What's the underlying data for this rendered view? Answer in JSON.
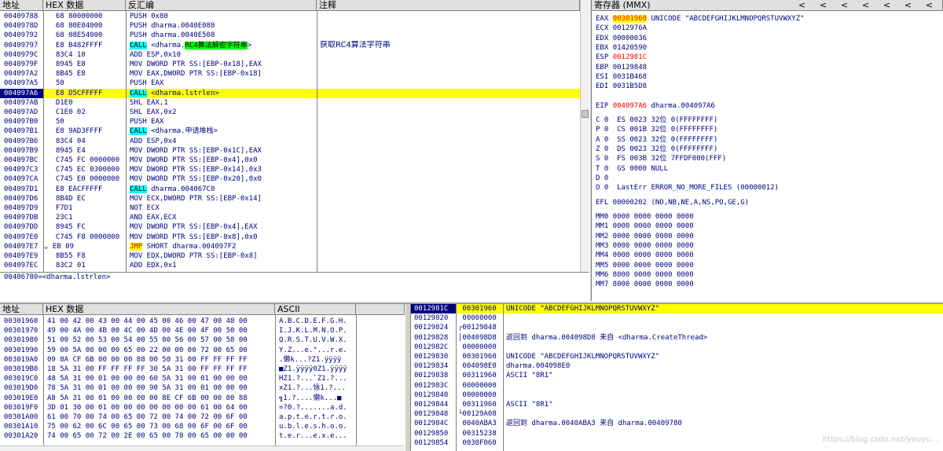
{
  "disasm": {
    "headers": {
      "addr": "地址",
      "hex": "HEX 数据",
      "asm": "反汇编",
      "comment": "注释"
    },
    "rows": [
      {
        "addr": "00409788",
        "hex": "68 80000000",
        "asm": "PUSH 0x80",
        "comment": ""
      },
      {
        "addr": "0040978D",
        "hex": "68 80E04000",
        "asm": "PUSH dharma.0040E080",
        "comment": ""
      },
      {
        "addr": "00409792",
        "hex": "68 08E54000",
        "asm": "PUSH dharma.0040E508",
        "comment": ""
      },
      {
        "addr": "00409797",
        "hex": "E8 B482FFFF",
        "asm_call": "CALL",
        "asm_pre": " <dharma.",
        "asm_green": "RC4算法解密字符串",
        "asm_post": ">",
        "comment": "获取RC4算法字符串"
      },
      {
        "addr": "0040979C",
        "hex": "83C4 10",
        "asm": "ADD ESP,0x10",
        "comment": ""
      },
      {
        "addr": "0040979F",
        "hex": "8945 E8",
        "asm": "MOV DWORD PTR SS:[EBP-0x18],EAX",
        "comment": ""
      },
      {
        "addr": "004097A2",
        "hex": "8B45 E8",
        "asm": "MOV EAX,DWORD PTR SS:[EBP-0x18]",
        "comment": ""
      },
      {
        "addr": "004097A5",
        "hex": "50",
        "asm": "PUSH EAX",
        "comment": ""
      },
      {
        "addr": "004097A6",
        "hex": "E8 D5CFFFFF",
        "asm_call": "CALL",
        "asm_pre": " <dharma.lstrlen>",
        "comment": "",
        "selected": true
      },
      {
        "addr": "004097AB",
        "hex": "D1E0",
        "asm": "SHL EAX,1",
        "comment": ""
      },
      {
        "addr": "004097AD",
        "hex": "C1E0 02",
        "asm": "SHL EAX,0x2",
        "comment": ""
      },
      {
        "addr": "004097B0",
        "hex": "50",
        "asm": "PUSH EAX",
        "comment": ""
      },
      {
        "addr": "004097B1",
        "hex": "E8 9AD3FFFF",
        "asm_call": "CALL",
        "asm_pre": " <dharma.申请堆栈>",
        "comment": ""
      },
      {
        "addr": "004097B6",
        "hex": "83C4 04",
        "asm": "ADD ESP,0x4",
        "comment": ""
      },
      {
        "addr": "004097B9",
        "hex": "8945 E4",
        "asm": "MOV DWORD PTR SS:[EBP-0x1C],EAX",
        "comment": ""
      },
      {
        "addr": "004097BC",
        "hex": "C745 FC 0000000",
        "asm": "MOV DWORD PTR SS:[EBP-0x4],0x0",
        "comment": ""
      },
      {
        "addr": "004097C3",
        "hex": "C745 EC 0300000",
        "asm": "MOV DWORD PTR SS:[EBP-0x14],0x3",
        "comment": ""
      },
      {
        "addr": "004097CA",
        "hex": "C745 E0 0000000",
        "asm": "MOV DWORD PTR SS:[EBP-0x20],0x0",
        "comment": ""
      },
      {
        "addr": "004097D1",
        "hex": "E8 EACFFFFF",
        "asm_call": "CALL",
        "asm_pre": " dharma.004067C0",
        "comment": ""
      },
      {
        "addr": "004097D6",
        "hex": "8B4D EC",
        "asm": "MOV ECX,DWORD PTR SS:[EBP-0x14]",
        "comment": ""
      },
      {
        "addr": "004097D9",
        "hex": "F7D1",
        "asm": "NOT ECX",
        "comment": ""
      },
      {
        "addr": "004097DB",
        "hex": "23C1",
        "asm": "AND EAX,ECX",
        "comment": ""
      },
      {
        "addr": "004097DD",
        "hex": "8945 FC",
        "asm": "MOV DWORD PTR SS:[EBP-0x4],EAX",
        "comment": ""
      },
      {
        "addr": "004097E0",
        "hex": "C745 F8 0000000",
        "asm": "MOV DWORD PTR SS:[EBP-0x8],0x0",
        "comment": ""
      },
      {
        "addr": "004097E7",
        "hex": "EB 09",
        "asm_jmp": "JMP",
        "asm_pre": " SHORT dharma.004097F2",
        "comment": "",
        "jmp_marker": "⌄"
      },
      {
        "addr": "004097E9",
        "hex": "8B55 F8",
        "asm": "MOV EDX,DWORD PTR SS:[EBP-0x8]",
        "comment": ""
      },
      {
        "addr": "004097EC",
        "hex": "83C2 01",
        "asm": "ADD EDX,0x1",
        "comment": ""
      }
    ],
    "info_line": "00406780=<dharma.lstrlen>"
  },
  "registers": {
    "title": "寄存器 (MMX)",
    "nav": [
      "<",
      "<",
      "<",
      "<",
      "<",
      "<",
      "<"
    ],
    "general": [
      {
        "name": "EAX",
        "value": "00301960",
        "extra": "UNICODE \"ABCDEFGHIJKLMNOPQRSTUVWXYZ\"",
        "highlight": true
      },
      {
        "name": "ECX",
        "value": "0012976A",
        "extra": ""
      },
      {
        "name": "EDX",
        "value": "00000036",
        "extra": ""
      },
      {
        "name": "EBX",
        "value": "01420590",
        "extra": ""
      },
      {
        "name": "ESP",
        "value": "0012981C",
        "extra": "",
        "red": true
      },
      {
        "name": "EBP",
        "value": "00129848",
        "extra": ""
      },
      {
        "name": "ESI",
        "value": "0031B468",
        "extra": ""
      },
      {
        "name": "EDI",
        "value": "0031B5D8",
        "extra": ""
      }
    ],
    "eip": {
      "name": "EIP",
      "value": "004097A6",
      "extra": "dharma.004097A6"
    },
    "flags": [
      "C 0  ES 0023 32位 0(FFFFFFFF)",
      "P 0  CS 001B 32位 0(FFFFFFFF)",
      "A 0  SS 0023 32位 0(FFFFFFFF)",
      "Z 0  DS 0023 32位 0(FFFFFFFF)",
      "S 0  FS 003B 32位 7FFDF000(FFF)",
      "T 0  GS 0000 NULL",
      "D 0",
      "O 0  LastErr ERROR_NO_MORE_FILES (00000012)"
    ],
    "efl": "EFL 00000202 (NO,NB,NE,A,NS,PO,GE,G)",
    "mmx": [
      "MM0 0000 0000 0000 0000",
      "MM1 0000 0000 0000 0000",
      "MM2 0000 0000 0000 0000",
      "MM3 0000 0000 0000 0000",
      "MM4 0000 0000 0000 0000",
      "MM5 0000 0000 0000 0000",
      "MM6 8000 0000 0000 0000",
      "MM7 8000 0000 0000 0000"
    ]
  },
  "dump": {
    "headers": {
      "addr": "地址",
      "hex": "HEX 数据",
      "ascii": "ASCII"
    },
    "rows": [
      {
        "addr": "00301960",
        "hex": "41 00 42 00 43 00 44 00 45 00 46 00 47 00 48 00",
        "ascii": "A.B.C.D.E.F.G.H."
      },
      {
        "addr": "00301970",
        "hex": "49 00 4A 00 4B 00 4C 00 4D 00 4E 00 4F 00 50 00",
        "ascii": "I.J.K.L.M.N.O.P."
      },
      {
        "addr": "00301980",
        "hex": "51 00 52 00 53 00 54 00 55 00 56 00 57 00 58 00",
        "ascii": "Q.R.S.T.U.V.W.X."
      },
      {
        "addr": "00301990",
        "hex": "59 00 5A 00 00 00 65 00 22 00 00 00 72 00 65 00",
        "ascii": "Y.Z...e.\"...r.e."
      },
      {
        "addr": "003019A0",
        "hex": "09 8A CF 6B 00 00 00 88 00 50 31 00 FF FF FF FF",
        "ascii": ".懒k...?Z1.ÿÿÿÿ"
      },
      {
        "addr": "003019B0",
        "hex": "18 5A 31 00 FF FF FF FF 30 5A 31 00 FF FF FF FF",
        "ascii": "■Z1.ÿÿÿÿ0Z1.ÿÿÿÿ"
      },
      {
        "addr": "003019C0",
        "hex": "48 5A 31 00 01 00 00 00 60 5A 31 00 01 00 00 00",
        "ascii": "HZ1.?...`Z1.?..."
      },
      {
        "addr": "003019D0",
        "hex": "78 5A 31 00 01 00 00 00 90 5A 31 00 01 00 00 00",
        "ascii": "xZ1.?...怺1.?..."
      },
      {
        "addr": "003019E0",
        "hex": "A8 5A 31 00 01 00 00 00 00 8E CF 6B 00 00 00 88",
        "ascii": "╗1.?....懒k...■"
      },
      {
        "addr": "003019F0",
        "hex": "3D 01 30 00 01 00 00 00 00 00 00 00 61 00 64 00",
        "ascii": "=?0.?.......a.d."
      },
      {
        "addr": "00301A00",
        "hex": "61 00 70 00 74 00 65 00 72 00 74 00 72 00 6F 00",
        "ascii": "a.p.t.e.r.t.r.o."
      },
      {
        "addr": "00301A10",
        "hex": "75 00 62 00 6C 00 65 00 73 00 68 00 6F 00 6F 00",
        "ascii": "u.b.l.e.s.h.o.o."
      },
      {
        "addr": "00301A20",
        "hex": "74 00 65 00 72 00 2E 00 65 00 78 00 65 00 00 00",
        "ascii": "t.e.r...e.x.e..."
      }
    ]
  },
  "stack": {
    "rows": [
      {
        "addr": "0012981C",
        "value": "00301960",
        "comment": "UNICODE \"ABCDEFGHIJKLMNOPQRSTUVWXYZ\"",
        "selected": true
      },
      {
        "addr": "00129820",
        "value": "00000000",
        "comment": ""
      },
      {
        "addr": "00129824",
        "value": "00129848",
        "comment": "",
        "bracket": "┌"
      },
      {
        "addr": "00129828",
        "value": "004098D8",
        "comment": "返回到 dharma.004098D8 来自 <dharma.CreateThread>",
        "bracket": "│"
      },
      {
        "addr": "0012982C",
        "value": "00000000",
        "comment": ""
      },
      {
        "addr": "00129830",
        "value": "00301960",
        "comment": "UNICODE \"ABCDEFGHIJKLMNOPQRSTUVWXYZ\""
      },
      {
        "addr": "00129834",
        "value": "004098E0",
        "comment": "dharma.004098E0"
      },
      {
        "addr": "00129838",
        "value": "00311960",
        "comment": "ASCII \"8R1\""
      },
      {
        "addr": "0012983C",
        "value": "00000000",
        "comment": ""
      },
      {
        "addr": "00129840",
        "value": "00000000",
        "comment": ""
      },
      {
        "addr": "00129844",
        "value": "00311960",
        "comment": "ASCII \"8R1\""
      },
      {
        "addr": "00129848",
        "value": "00129A08",
        "comment": "",
        "bracket": "└"
      },
      {
        "addr": "0012984C",
        "value": "0040ABA3",
        "comment": "返回到 dharma.0040ABA3 来自 dharma.00409780"
      },
      {
        "addr": "00129850",
        "value": "00315238",
        "comment": ""
      },
      {
        "addr": "00129854",
        "value": "0030F060",
        "comment": ""
      }
    ]
  },
  "watermark": "https://blog.csdn.net/youyu..."
}
